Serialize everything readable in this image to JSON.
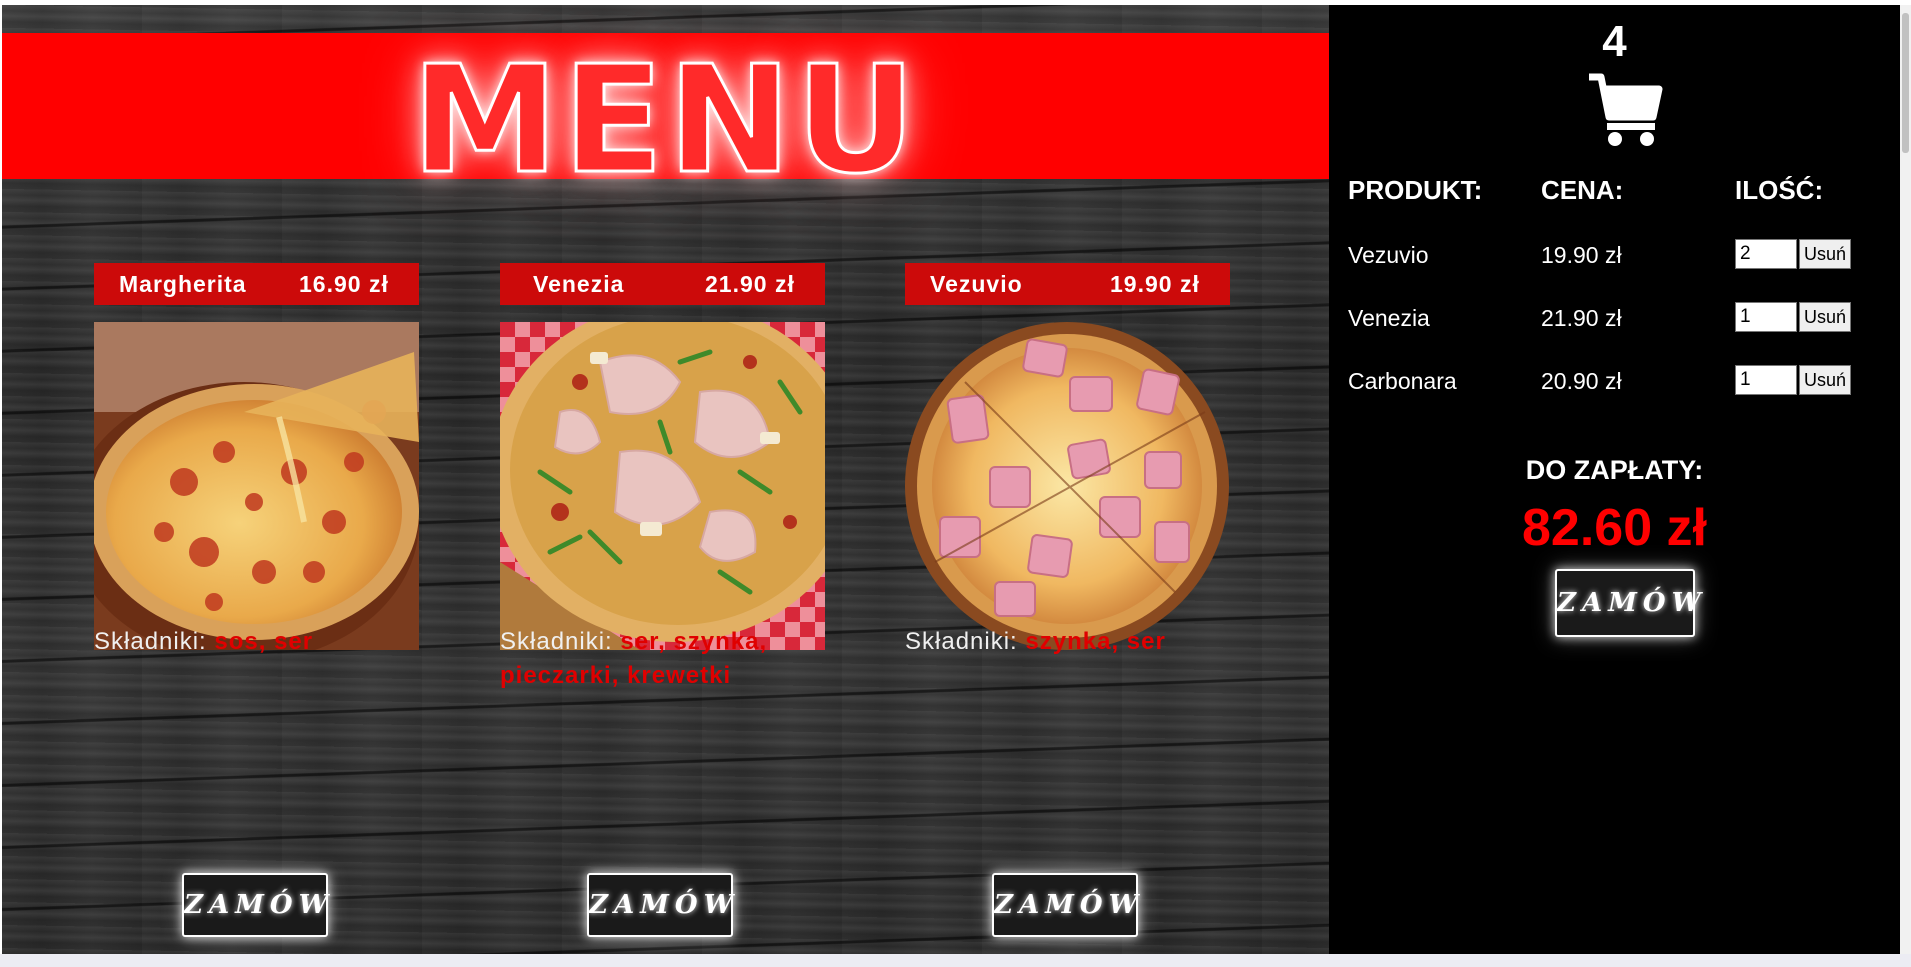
{
  "menu": {
    "title": "MENU",
    "pizzas": [
      {
        "name": "Margherita",
        "price": "16.90 zł",
        "ingredients_label": "Składniki:",
        "ingredients": "sos, ser",
        "order_label": "ZAMÓW"
      },
      {
        "name": "Venezia",
        "price": "21.90 zł",
        "ingredients_label": "Składniki:",
        "ingredients": "ser, szynka, pieczarki, krewetki",
        "order_label": "ZAMÓW"
      },
      {
        "name": "Vezuvio",
        "price": "19.90 zł",
        "ingredients_label": "Składniki:",
        "ingredients": "szynka, ser",
        "order_label": "ZAMÓW"
      }
    ]
  },
  "cart": {
    "count": "4",
    "icon": "cart-icon",
    "headers": {
      "product": "PRODUKT:",
      "price": "CENA:",
      "quantity": "ILOŚĆ:"
    },
    "items": [
      {
        "name": "Vezuvio",
        "price": "19.90 zł",
        "quantity": "2",
        "remove_label": "Usuń"
      },
      {
        "name": "Venezia",
        "price": "21.90 zł",
        "quantity": "1",
        "remove_label": "Usuń"
      },
      {
        "name": "Carbonara",
        "price": "20.90 zł",
        "quantity": "1",
        "remove_label": "Usuń"
      }
    ],
    "total_label": "DO ZAPŁATY:",
    "total_value": "82.60 zł",
    "order_label": "ZAMÓW"
  },
  "colors": {
    "accent": "#ff0000",
    "header_red": "#cc0a0a",
    "panel": "#000000"
  }
}
